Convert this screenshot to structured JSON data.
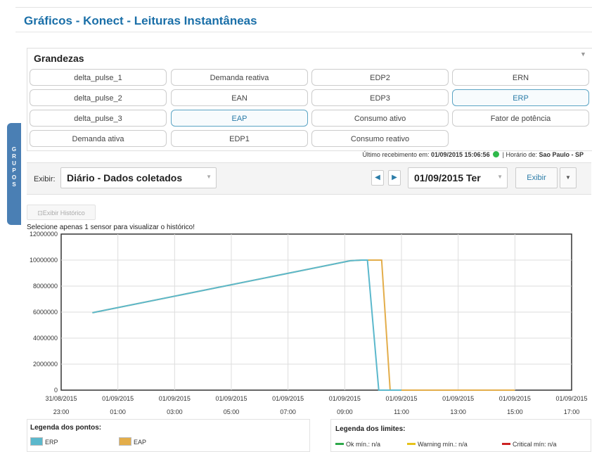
{
  "page": {
    "title": "Gráficos - Konect - Leituras Instantâneas"
  },
  "side_tab": {
    "label": "GRUPOS"
  },
  "grandezas": {
    "title": "Grandezas",
    "buttons": [
      {
        "label": "delta_pulse_1",
        "selected": false
      },
      {
        "label": "Demanda reativa",
        "selected": false
      },
      {
        "label": "EDP2",
        "selected": false
      },
      {
        "label": "ERN",
        "selected": false
      },
      {
        "label": "delta_pulse_2",
        "selected": false
      },
      {
        "label": "EAN",
        "selected": false
      },
      {
        "label": "EDP3",
        "selected": false
      },
      {
        "label": "ERP",
        "selected": true
      },
      {
        "label": "delta_pulse_3",
        "selected": false
      },
      {
        "label": "EAP",
        "selected": true
      },
      {
        "label": "Consumo ativo",
        "selected": false
      },
      {
        "label": "Fator de potência",
        "selected": false
      },
      {
        "label": "Demanda ativa",
        "selected": false
      },
      {
        "label": "EDP1",
        "selected": false
      },
      {
        "label": "Consumo reativo",
        "selected": false
      }
    ]
  },
  "status": {
    "last_label": "Último recebimento em:",
    "last_value": "01/09/2015 15:06:56",
    "tz_label": "| Horário de:",
    "tz_value": "Sao Paulo - SP"
  },
  "toolbar": {
    "exibir_label": "Exibir:",
    "mode_value": "Diário - Dados coletados",
    "date_value": "01/09/2015 Ter",
    "exibir_button": "Exibir"
  },
  "history": {
    "button_label": "Exibir Histórico",
    "hint": "Selecione apenas 1 sensor para visualizar o histórico!"
  },
  "colors": {
    "erp": "#5bb8cc",
    "eap": "#e3ad4a",
    "ok": "#2ea84a",
    "warning": "#e6c21a",
    "critical": "#cc2222",
    "accent": "#1a6fa8"
  },
  "chart_data": {
    "type": "line",
    "ylim": [
      0,
      12000000
    ],
    "yticks": [
      "12000000",
      "10000000",
      "8000000",
      "6000000",
      "4000000",
      "2000000",
      "0"
    ],
    "xticks": [
      [
        "31/08/2015",
        "23:00"
      ],
      [
        "01/09/2015",
        "01:00"
      ],
      [
        "01/09/2015",
        "03:00"
      ],
      [
        "01/09/2015",
        "05:00"
      ],
      [
        "01/09/2015",
        "07:00"
      ],
      [
        "01/09/2015",
        "09:00"
      ],
      [
        "01/09/2015",
        "11:00"
      ],
      [
        "01/09/2015",
        "13:00"
      ],
      [
        "01/09/2015",
        "15:00"
      ],
      [
        "01/09/2015",
        "17:00"
      ]
    ],
    "x_range_hours": [
      0,
      18
    ],
    "series": [
      {
        "name": "EAP",
        "points": [
          [
            1.1,
            5950000
          ],
          [
            10.2,
            9950000
          ],
          [
            10.6,
            10000000
          ],
          [
            11.3,
            10000000
          ],
          [
            11.6,
            0
          ],
          [
            16.0,
            0
          ]
        ]
      },
      {
        "name": "ERP",
        "points": [
          [
            1.1,
            5950000
          ],
          [
            10.2,
            9950000
          ],
          [
            10.6,
            10000000
          ],
          [
            10.8,
            10000000
          ],
          [
            11.2,
            0
          ],
          [
            12.0,
            0
          ]
        ]
      }
    ],
    "grid": true
  },
  "legend_points": {
    "title": "Legenda dos pontos:",
    "items": [
      "ERP",
      "EAP"
    ]
  },
  "legend_limits": {
    "title": "Legenda dos limites:",
    "items": [
      "Ok mín.: n/a",
      "Warning mín.: n/a",
      "Critical mín: n/a"
    ]
  }
}
